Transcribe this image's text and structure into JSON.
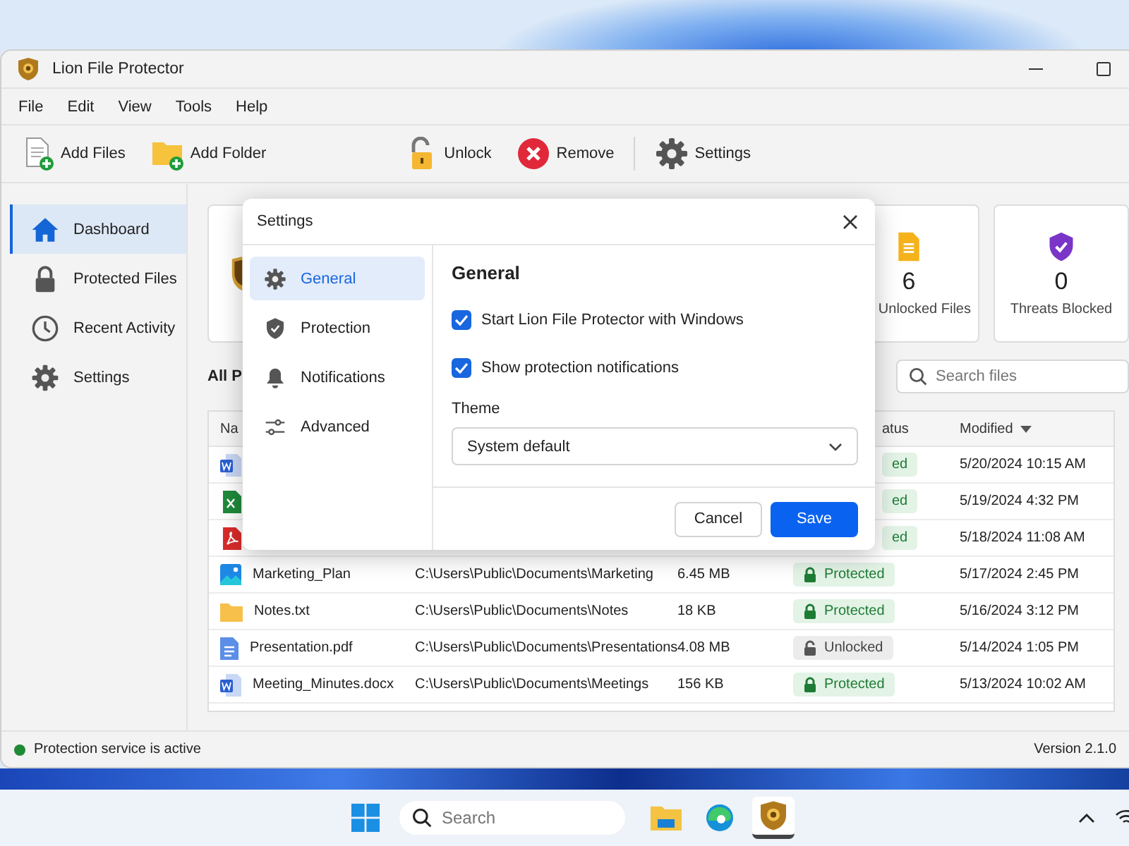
{
  "window": {
    "title": "Lion File Protector"
  },
  "menu": [
    "File",
    "Edit",
    "View",
    "Tools",
    "Help"
  ],
  "toolbar": [
    {
      "label": "Add Files",
      "kind": "add-file"
    },
    {
      "label": "Add Folder",
      "kind": "add-folder"
    },
    {
      "label": "Unlock",
      "kind": "unlock"
    },
    {
      "label": "Remove",
      "kind": "remove"
    },
    {
      "label": "Settings",
      "kind": "settings"
    }
  ],
  "sidebar": {
    "items": [
      {
        "label": "Dashboard",
        "kind": "home",
        "selected": true
      },
      {
        "label": "Protected Files",
        "kind": "lock",
        "selected": false
      },
      {
        "label": "Recent Activity",
        "kind": "clock",
        "selected": false
      },
      {
        "label": "Settings",
        "kind": "gear",
        "selected": false
      }
    ]
  },
  "stats": [
    {
      "kind": "shield-gold"
    },
    {
      "value": "6",
      "label": "Unlocked Files",
      "kind": "document"
    },
    {
      "value": "0",
      "label": "Threats Blocked",
      "kind": "shield-check"
    }
  ],
  "section_title": "All P",
  "search": {
    "placeholder": "Search files"
  },
  "table": {
    "column_1": "Na",
    "column_4": "atus",
    "column_5": "Modified",
    "sort_descending": true,
    "rows": [
      {
        "kind": "word",
        "locked": true,
        "status_text": "ed",
        "modified": "5/20/2024 10:15 AM"
      },
      {
        "kind": "excel",
        "locked": true,
        "status_text": "ed",
        "modified": "5/19/2024 4:32 PM"
      },
      {
        "kind": "pdf",
        "locked": true,
        "status_text": "ed",
        "modified": "5/18/2024 11:08 AM"
      },
      {
        "kind": "image",
        "name": "Marketing_Plan",
        "path": "C:\\Users\\Public\\Documents\\Marketing",
        "size": "6.45 MB",
        "locked": true,
        "status_text": "Protected",
        "modified": "5/17/2024 2:45 PM"
      },
      {
        "kind": "folder",
        "name": "Notes.txt",
        "path": "C:\\Users\\Public\\Documents\\Notes",
        "size": "18 KB",
        "locked": true,
        "status_text": "Protected",
        "modified": "5/16/2024 3:12 PM"
      },
      {
        "kind": "doc",
        "name": "Presentation.pdf",
        "path": "C:\\Users\\Public\\Documents\\Presentations",
        "size": "4.08 MB",
        "locked": false,
        "status_text": "Unlocked",
        "modified": "5/14/2024 1:05 PM"
      },
      {
        "kind": "word",
        "name": "Meeting_Minutes.docx",
        "path": "C:\\Users\\Public\\Documents\\Meetings",
        "size": "156 KB",
        "locked": true,
        "status_text": "Protected",
        "modified": "5/13/2024 10:02 AM"
      }
    ]
  },
  "status_bar": {
    "text": "Protection service is active",
    "active": true,
    "version": "Version 2.1.0"
  },
  "dialog": {
    "title": "Settings",
    "nav": [
      {
        "label": "General",
        "kind": "gear",
        "selected": true
      },
      {
        "label": "Protection",
        "kind": "shield",
        "selected": false
      },
      {
        "label": "Notifications",
        "kind": "bell",
        "selected": false
      },
      {
        "label": "Advanced",
        "kind": "sliders",
        "selected": false
      }
    ],
    "heading": "General",
    "options": [
      {
        "label": "Start Lion File Protector with Windows",
        "checked": true
      },
      {
        "label": "Show protection notifications",
        "checked": true
      }
    ],
    "theme": {
      "label": "Theme",
      "value": "System default"
    },
    "buttons": [
      {
        "label": "Cancel",
        "kind": "secondary"
      },
      {
        "label": "Save",
        "kind": "primary"
      }
    ]
  },
  "taskbar": {
    "search": {
      "placeholder": "Search"
    },
    "apps": [
      {
        "kind": "folder",
        "active": false
      },
      {
        "kind": "edge",
        "active": false
      },
      {
        "kind": "lion",
        "active": true
      }
    ]
  }
}
